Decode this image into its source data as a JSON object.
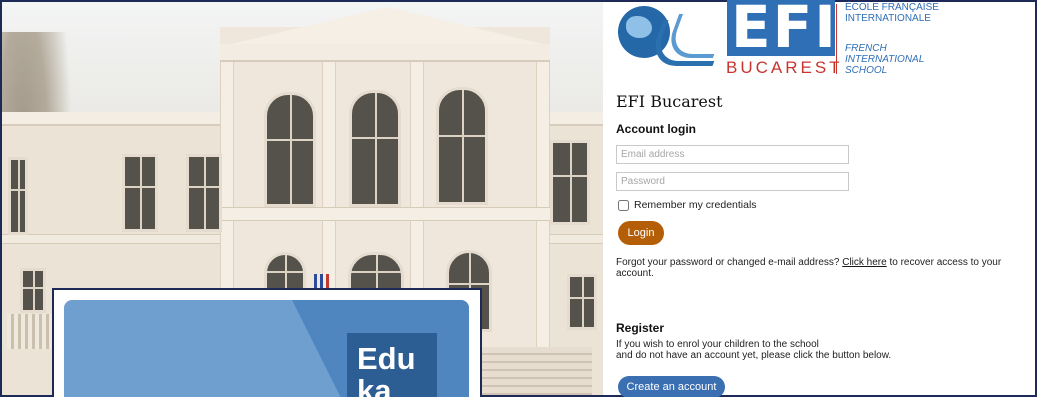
{
  "brand": {
    "logo_text": "EFI",
    "city": "BUCAREST",
    "french_name": "ÉCOLE FRANÇAISE INTERNATIONALE",
    "english_name": "FRENCH INTERNATIONAL SCHOOL",
    "colors": {
      "blue": "#2f6fb6",
      "red": "#c8352f"
    }
  },
  "school_name": "EFI Bucarest",
  "login": {
    "heading": "Account login",
    "email_placeholder": "Email address",
    "password_placeholder": "Password",
    "remember_label": "Remember my credentials",
    "button_label": "Login",
    "forgot_prefix": "Forgot your password or changed e-mail address?",
    "forgot_link": "Click here",
    "forgot_suffix": "to recover access to your account.",
    "button_color": "#b45e07"
  },
  "register": {
    "heading": "Register",
    "line1": "If you wish to enrol your children to the school",
    "line2": "and do not have an account yet, please click the button below.",
    "button_label": "Create an account",
    "button_color": "#3a6fb1"
  },
  "eduka": {
    "logo_text": "Edu\nka"
  }
}
